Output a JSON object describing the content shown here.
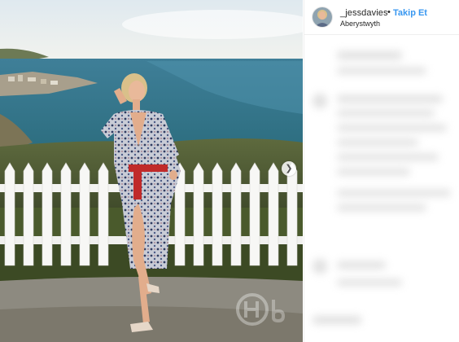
{
  "post": {
    "username": "_jessdavies",
    "separator": "•",
    "follow_label": "Takip Et",
    "location": "Aberystwyth",
    "next_icon": "chevron-right-icon"
  },
  "colors": {
    "follow": "#3897f0",
    "text": "#262626",
    "border": "#efefef"
  }
}
